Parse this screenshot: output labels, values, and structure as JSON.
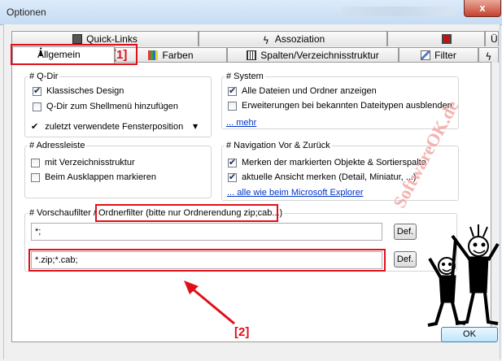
{
  "window": {
    "title": "Optionen",
    "close_symbol": "x"
  },
  "tabs_back": [
    {
      "label": "Quick-Links",
      "icon": "quicklinks-icon"
    },
    {
      "label": "Assoziation",
      "icon": "lightning-icon"
    },
    {
      "label": "",
      "icon": "red-square-icon"
    },
    {
      "label": "Ü",
      "icon": ""
    }
  ],
  "tabs_front": [
    {
      "label": "Allgemein",
      "icon": "info-icon",
      "active": true
    },
    {
      "label": "Farben",
      "icon": "palette-icon"
    },
    {
      "label": "Spalten/Verzeichnisstruktur",
      "icon": "grid-icon"
    },
    {
      "label": "Filter",
      "icon": "brush-icon"
    },
    {
      "label": "",
      "icon": "lightning-icon"
    }
  ],
  "qdir": {
    "title": "# Q-Dir",
    "classic_design": {
      "label": "Klassisches Design",
      "checked": true
    },
    "shell_menu": {
      "label": "Q-Dir zum Shellmenü hinzufügen",
      "checked": false
    },
    "recent_positions": {
      "label": "zuletzt verwendete Fensterposition",
      "check_symbol": "✔",
      "dropdown_symbol": "▼"
    }
  },
  "system": {
    "title": "# System",
    "show_all": {
      "label": "Alle Dateien und Ordner anzeigen",
      "checked": true
    },
    "hide_ext": {
      "label": "Erweiterungen bei bekannten Dateitypen ausblenden",
      "checked": false
    },
    "more_link": "... mehr"
  },
  "address": {
    "title": "# Adressleiste",
    "with_tree": {
      "label": "mit Verzeichnisstruktur",
      "checked": false
    },
    "mark_expand": {
      "label": "Beim Ausklappen markieren",
      "checked": false
    }
  },
  "navigation": {
    "title": "# Navigation Vor & Zurück",
    "remember_marked": {
      "label": "Merken der markierten Objekte & Sortierspalte",
      "checked": true
    },
    "remember_view": {
      "label": "aktuelle Ansicht merken (Detail, Miniatur, ...)",
      "checked": true
    },
    "explorer_link": "... alle wie beim Microsoft Explorer"
  },
  "preview_filter": {
    "title_part1": "# Vorschaufilter / ",
    "title_part2": "Ordnerfilter (bitte nur Ordnerendung zip;cab...)",
    "field1_value": "*;",
    "field2_value": "*.zip;*.cab;",
    "def_label": "Def."
  },
  "ok_label": "OK",
  "annotations": {
    "label1": "[1]",
    "label2": "[2]",
    "color": "#e0101a"
  },
  "watermark": "SoftwareOK.de"
}
